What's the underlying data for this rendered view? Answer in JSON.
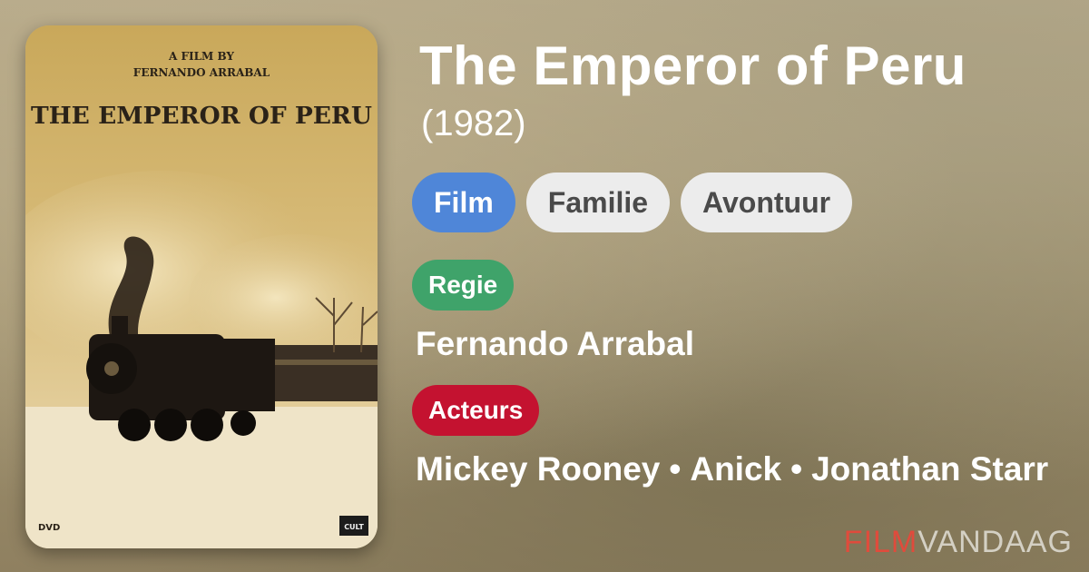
{
  "movie": {
    "title": "The Emperor of Peru",
    "year": "(1982)"
  },
  "poster": {
    "line1": "A FILM BY",
    "line2": "FERNANDO ARRABAL",
    "line3": "THE EMPEROR OF PERU",
    "dvd_mark": "DVD",
    "label_mark": "CULT"
  },
  "genres": [
    "Film",
    "Familie",
    "Avontuur"
  ],
  "director": {
    "badge": "Regie",
    "names": [
      "Fernando Arrabal"
    ]
  },
  "actors": {
    "badge": "Acteurs",
    "names": [
      "Mickey Rooney",
      "Anick",
      "Jonathan Starr"
    ],
    "separator": "•"
  },
  "brand": {
    "part1": "FILM",
    "part2": "VANDAAG"
  },
  "colors": {
    "genre_primary": "#4f86d8",
    "genre_secondary": "#ececec",
    "director_badge": "#3fa36a",
    "actors_badge": "#c41230",
    "brand_red": "#e04b3c"
  }
}
